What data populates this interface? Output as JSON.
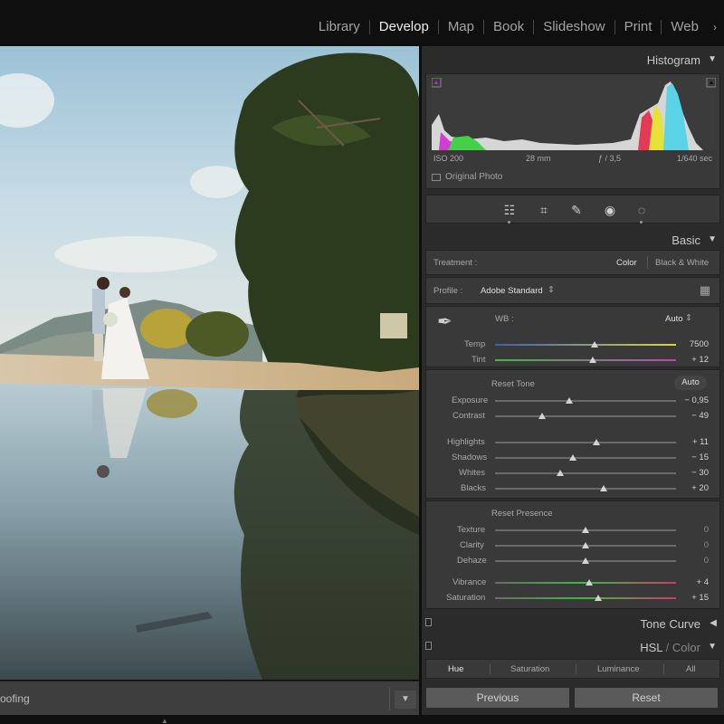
{
  "modules": {
    "items": [
      "Library",
      "Develop",
      "Map",
      "Book",
      "Slideshow",
      "Print",
      "Web"
    ],
    "active": "Develop",
    "more_glyph": "›"
  },
  "toolbar": {
    "label": "oofing",
    "caret_icon": "chevron-down-icon"
  },
  "histogram": {
    "title": "Histogram",
    "iso": "ISO 200",
    "focal": "28 mm",
    "aperture": "ƒ / 3,5",
    "shutter": "1/640 sec",
    "original_photo_label": "Original Photo"
  },
  "tools": [
    "sliders-icon",
    "crop-icon",
    "heal-icon",
    "redeye-icon",
    "mask-icon"
  ],
  "basic": {
    "title": "Basic",
    "treatment_label": "Treatment :",
    "treatment_color": "Color",
    "treatment_bw": "Black & White",
    "profile_label": "Profile :",
    "profile_value": "Adobe Standard",
    "wb_label": "WB :",
    "wb_value": "Auto",
    "temp": {
      "label": "Temp",
      "value": "7500",
      "pos": 0.55
    },
    "tint": {
      "label": "Tint",
      "value": "+ 12",
      "pos": 0.54
    },
    "reset_tone": "Reset Tone",
    "auto_button": "Auto",
    "exposure": {
      "label": "Exposure",
      "value": "− 0,95",
      "pos": 0.41
    },
    "contrast": {
      "label": "Contrast",
      "value": "− 49",
      "pos": 0.26
    },
    "highlights": {
      "label": "Highlights",
      "value": "+ 11",
      "pos": 0.56
    },
    "shadows": {
      "label": "Shadows",
      "value": "− 15",
      "pos": 0.43
    },
    "whites": {
      "label": "Whites",
      "value": "− 30",
      "pos": 0.36
    },
    "blacks": {
      "label": "Blacks",
      "value": "+ 20",
      "pos": 0.6
    },
    "reset_presence": "Reset Presence",
    "texture": {
      "label": "Texture",
      "value": "0",
      "pos": 0.5
    },
    "clarity": {
      "label": "Clarity",
      "value": "0",
      "pos": 0.5
    },
    "dehaze": {
      "label": "Dehaze",
      "value": "0",
      "pos": 0.5
    },
    "vibrance": {
      "label": "Vibrance",
      "value": "+ 4",
      "pos": 0.52
    },
    "saturation": {
      "label": "Saturation",
      "value": "+ 15",
      "pos": 0.57
    }
  },
  "tone_curve": {
    "title": "Tone Curve"
  },
  "hsl": {
    "title_a": "HSL",
    "title_sep": "/",
    "title_b": "Color",
    "tabs": [
      "Hue",
      "Saturation",
      "Luminance",
      "All"
    ],
    "selected_tab": "Hue"
  },
  "buttons": {
    "previous": "Previous",
    "reset": "Reset"
  },
  "colors": {
    "panel_bg": "#2b2b2b",
    "box_bg": "#393939",
    "slider_thumb": "#d4d4d4"
  }
}
